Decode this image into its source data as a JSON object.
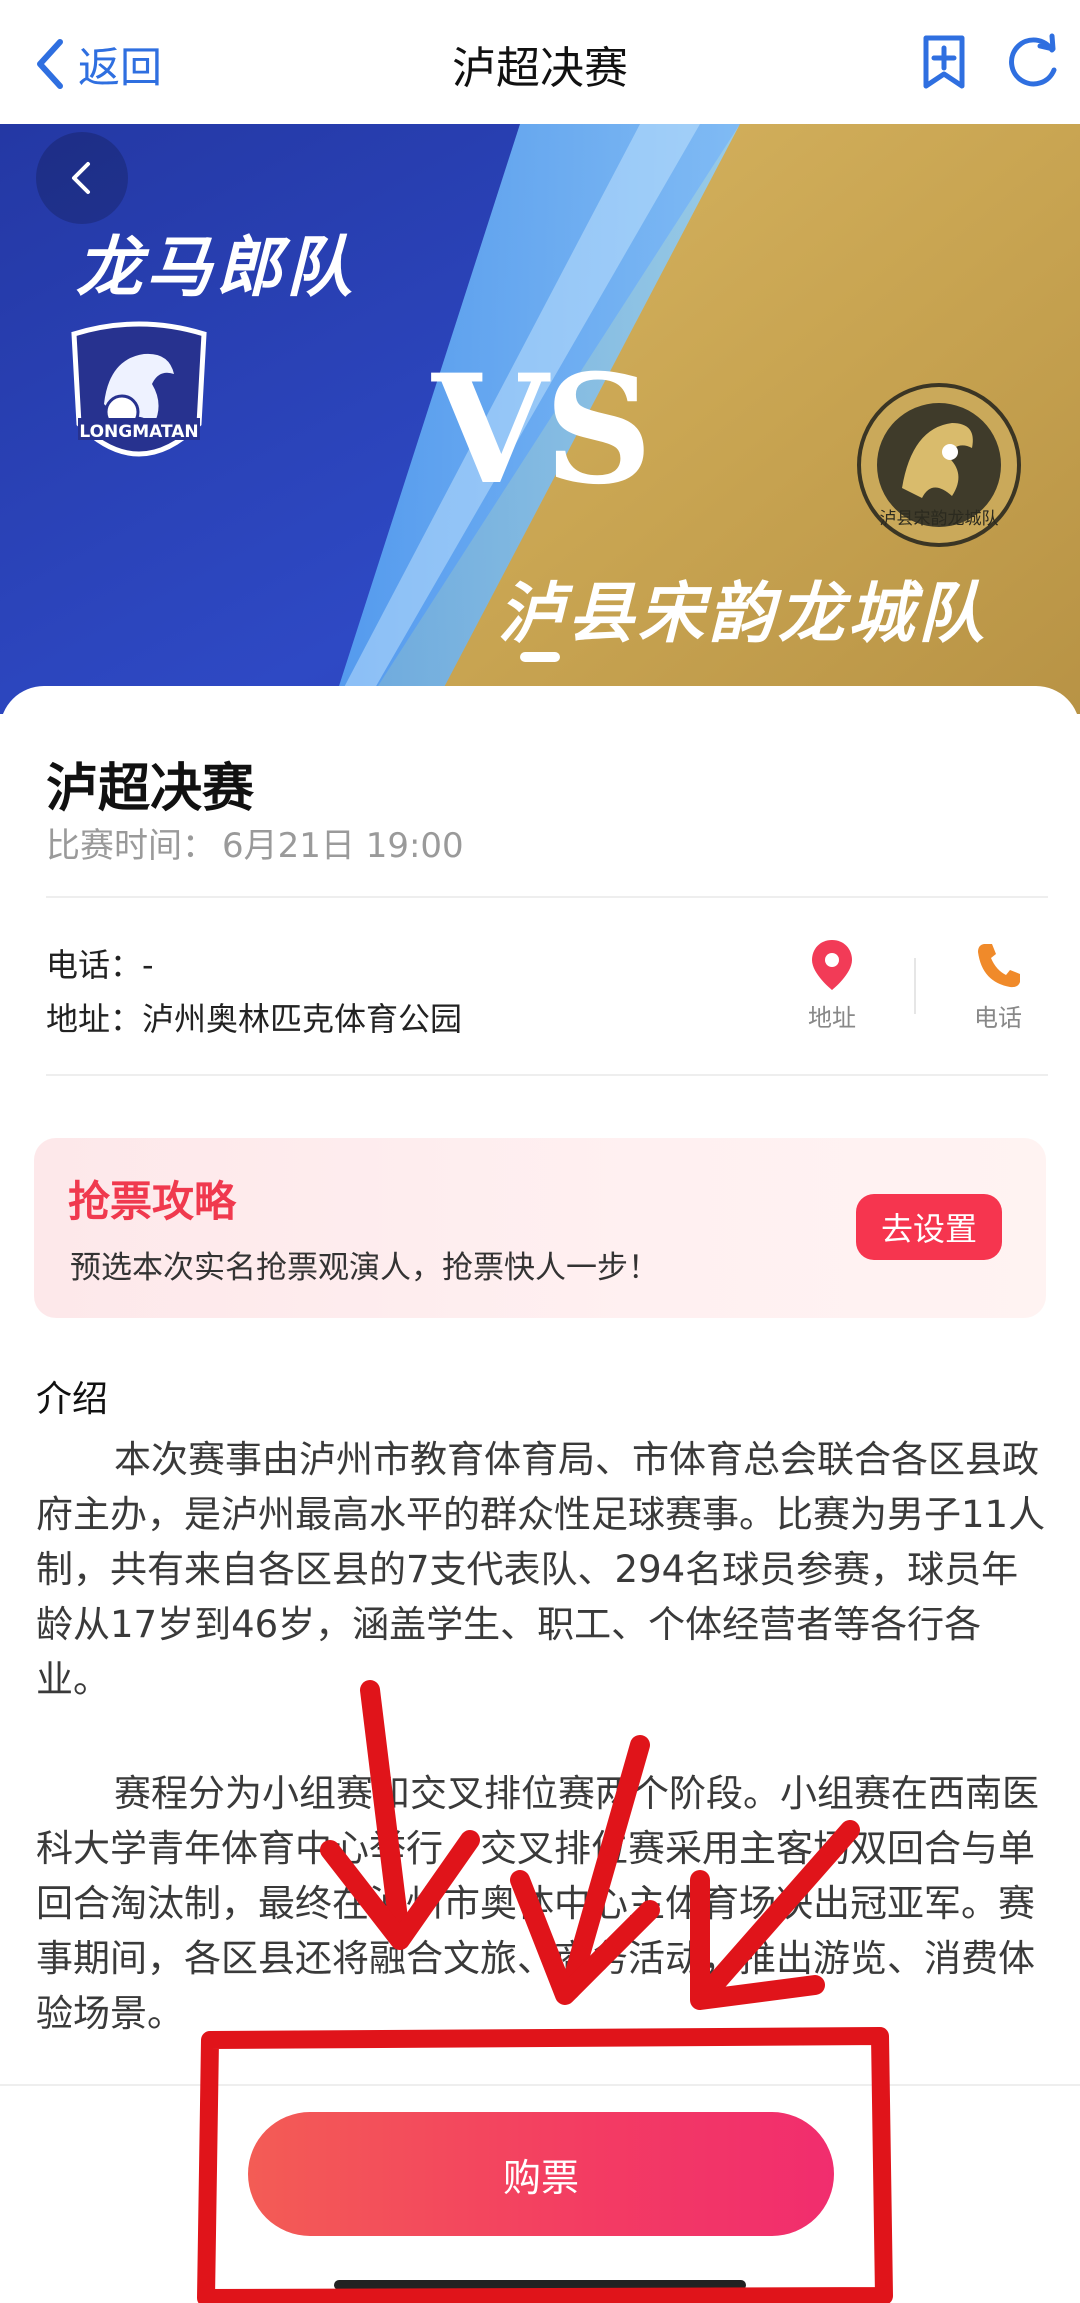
{
  "nav": {
    "back_label": "返回",
    "title": "泸超决赛"
  },
  "banner": {
    "team_left": "龙马郎队",
    "team_left_crest": "LONGMATAN",
    "vs": "VS",
    "team_right": "泸县宋韵龙城队",
    "team_right_crest": "泸县宋韵龙城队",
    "colors": {
      "left": "#2c3fb0",
      "right": "#c9a552"
    }
  },
  "event": {
    "title": "泸超决赛",
    "time_label": "比赛时间：",
    "time_value": "6月21日 19:00"
  },
  "contact": {
    "phone_label": "电话：",
    "phone_value": "-",
    "address_label": "地址：",
    "address_value": "泸州奥林匹克体育公园",
    "address_action": "地址",
    "phone_action": "电话"
  },
  "strategy": {
    "title": "抢票攻略",
    "desc": "预选本次实名抢票观演人，抢票快人一步！",
    "button": "去设置"
  },
  "intro": {
    "heading": "介绍",
    "para1": "本次赛事由泸州市教育体育局、市体育总会联合各区县政府主办，是泸州最高水平的群众性足球赛事。比赛为男子11人制，共有来自各区县的7支代表队、294名球员参赛，球员年龄从17岁到46岁，涵盖学生、职工、个体经营者等各行各业。",
    "para2": "赛程分为小组赛和交叉排位赛两个阶段。小组赛在西南医科大学青年体育中心举行，交叉排位赛采用主客场双回合与单回合淘汰制，最终在泸州市奥体中心主体育场决出冠亚军。赛事期间，各区县还将融合文旅、商务活动，推出游览、消费体验场景。"
  },
  "footer": {
    "buy_button": "购票"
  },
  "icons": {
    "back": "chevron-left-icon",
    "bookmark": "bookmark-add-icon",
    "refresh": "refresh-icon",
    "location": "location-pin-icon",
    "phone": "phone-icon"
  },
  "accent_colors": {
    "nav_blue": "#2f6fe0",
    "primary_red": "#f6354f",
    "location_red": "#f23b57",
    "phone_orange": "#f08a2a",
    "annotation_red": "#e0141a"
  }
}
